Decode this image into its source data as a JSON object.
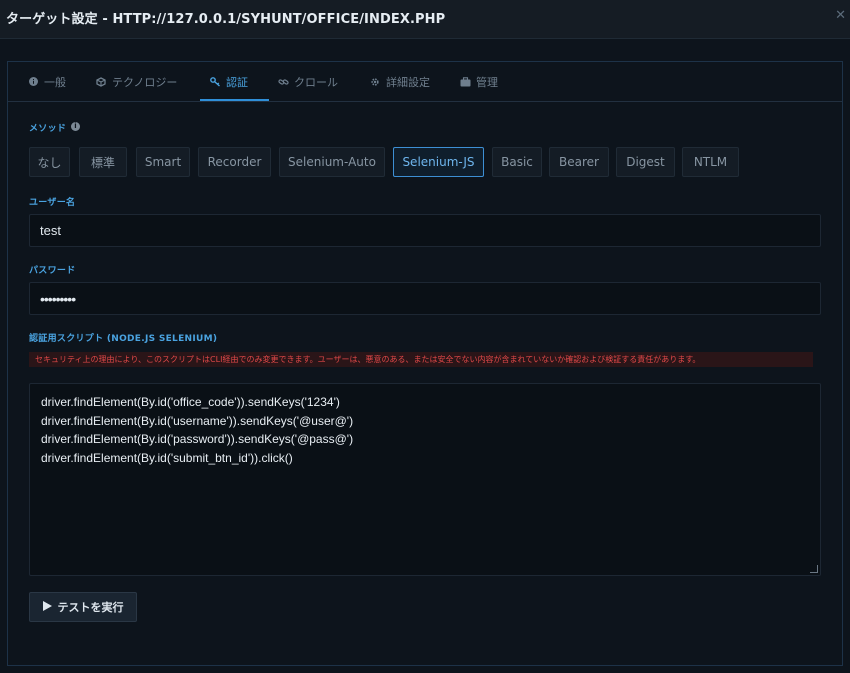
{
  "window": {
    "title": "ターゲット設定 - HTTP://127.0.0.1/SYHUNT/OFFICE/INDEX.PHP",
    "close_glyph": "✕"
  },
  "tabs": [
    {
      "label": "一般",
      "icon": "info-icon"
    },
    {
      "label": "テクノロジー",
      "icon": "cube-icon"
    },
    {
      "label": "認証",
      "icon": "key-icon",
      "active": true
    },
    {
      "label": "クロール",
      "icon": "link-icon"
    },
    {
      "label": "詳細設定",
      "icon": "gear-icon"
    },
    {
      "label": "管理",
      "icon": "briefcase-icon"
    }
  ],
  "method": {
    "label": "メソッド",
    "options": [
      "なし",
      "標準",
      "Smart",
      "Recorder",
      "Selenium-Auto",
      "Selenium-JS",
      "Basic",
      "Bearer",
      "Digest",
      "NTLM"
    ],
    "selected": "Selenium-JS"
  },
  "username": {
    "label": "ユーザー名",
    "value": "test"
  },
  "password": {
    "label": "パスワード",
    "value": "•••••••••"
  },
  "script": {
    "label": "認証用スクリプト (NODE.JS SELENIUM)",
    "warning": "セキュリティ上の理由により、このスクリプトはCLI経由でのみ変更できます。ユーザーは、悪意のある、または安全でない内容が含まれていないか確認および検証する責任があります。",
    "lines": [
      "driver.findElement(By.id('office_code')).sendKeys('1234')",
      "driver.findElement(By.id('username')).sendKeys('@user@')",
      "driver.findElement(By.id('password')).sendKeys('@pass@')",
      "driver.findElement(By.id('submit_btn_id')).click()"
    ]
  },
  "run_button": {
    "label": "テストを実行",
    "icon": "play-icon"
  },
  "colors": {
    "accent": "#2f8fd8",
    "background": "#0d141c",
    "warning": "#e04848"
  }
}
